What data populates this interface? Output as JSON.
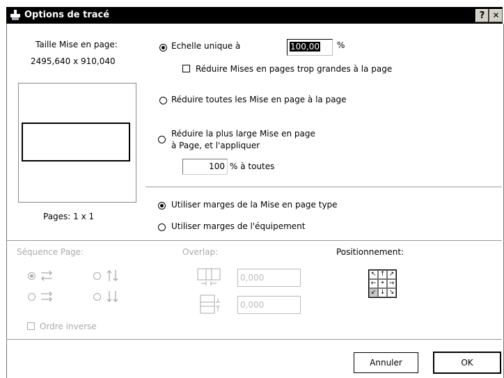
{
  "window": {
    "title": "Options de tracé",
    "help_label": "?",
    "close_label": "✕"
  },
  "layout_info": {
    "size_label": "Taille Mise en page:",
    "size_value": "2495,640 x 910,040",
    "pages_label": "Pages: 1 x 1"
  },
  "scale": {
    "unique_label": "Echelle unique à",
    "unique_value": "100,00",
    "unique_unit": "%",
    "reduce_too_large_label": "Réduire Mises en pages trop grandes à la page",
    "reduce_all_label": "Réduire toutes les Mise en page à la page",
    "reduce_largest_line1": "Réduire la plus large Mise en page",
    "reduce_largest_line2": "à Page, et l'appliquer",
    "apply_all_value": "100",
    "apply_all_suffix": "% à toutes"
  },
  "margins": {
    "layout_margins_label": "Utiliser marges de la Mise en page type",
    "device_margins_label": "Utiliser marges de l'équipement"
  },
  "sequence": {
    "title": "Séquence Page:",
    "reverse_label": "Ordre inverse"
  },
  "overlap": {
    "title": "Overlap:",
    "horizontal_value": "0,000",
    "vertical_value": "0,000"
  },
  "positioning": {
    "title": "Positionnement:",
    "arrows": [
      "↖",
      "↑",
      "↗",
      "←",
      "•",
      "→",
      "↙",
      "↓",
      "↘"
    ]
  },
  "buttons": {
    "cancel": "Annuler",
    "ok": "OK"
  }
}
